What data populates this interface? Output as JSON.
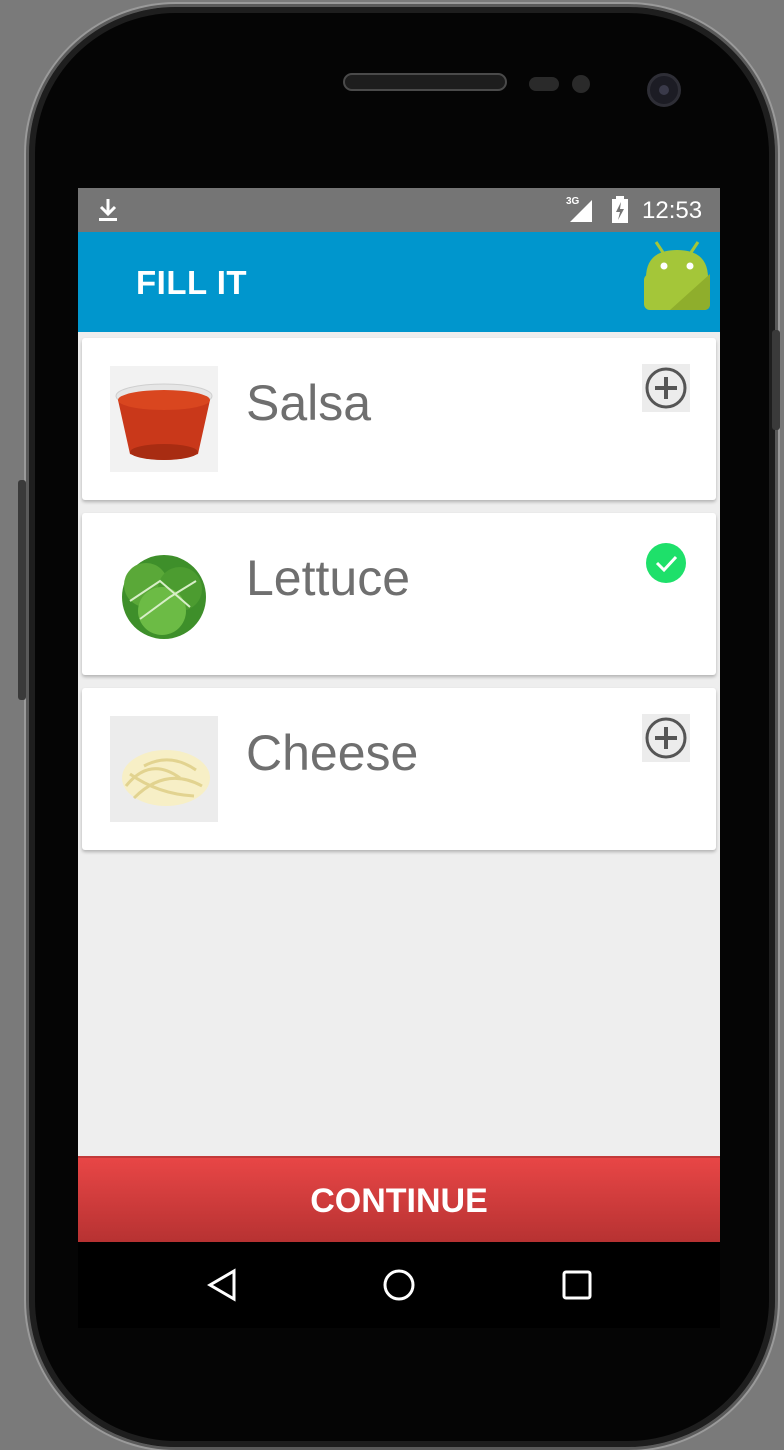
{
  "status_bar": {
    "network": "3G",
    "time": "12:53"
  },
  "app_bar": {
    "title": "FILL IT"
  },
  "items": [
    {
      "label": "Salsa",
      "image": "salsa-cup",
      "state": "add",
      "action_icon": "plus-circle-icon"
    },
    {
      "label": "Lettuce",
      "image": "lettuce",
      "state": "selected",
      "action_icon": "check-circle-icon"
    },
    {
      "label": "Cheese",
      "image": "shredded-cheese",
      "state": "add",
      "action_icon": "plus-circle-icon"
    }
  ],
  "continue_label": "CONTINUE",
  "colors": {
    "app_bar": "#0096cd",
    "status_bar": "#757575",
    "continue": "#e84646",
    "check": "#1ee06a",
    "background": "#eeeeee"
  }
}
